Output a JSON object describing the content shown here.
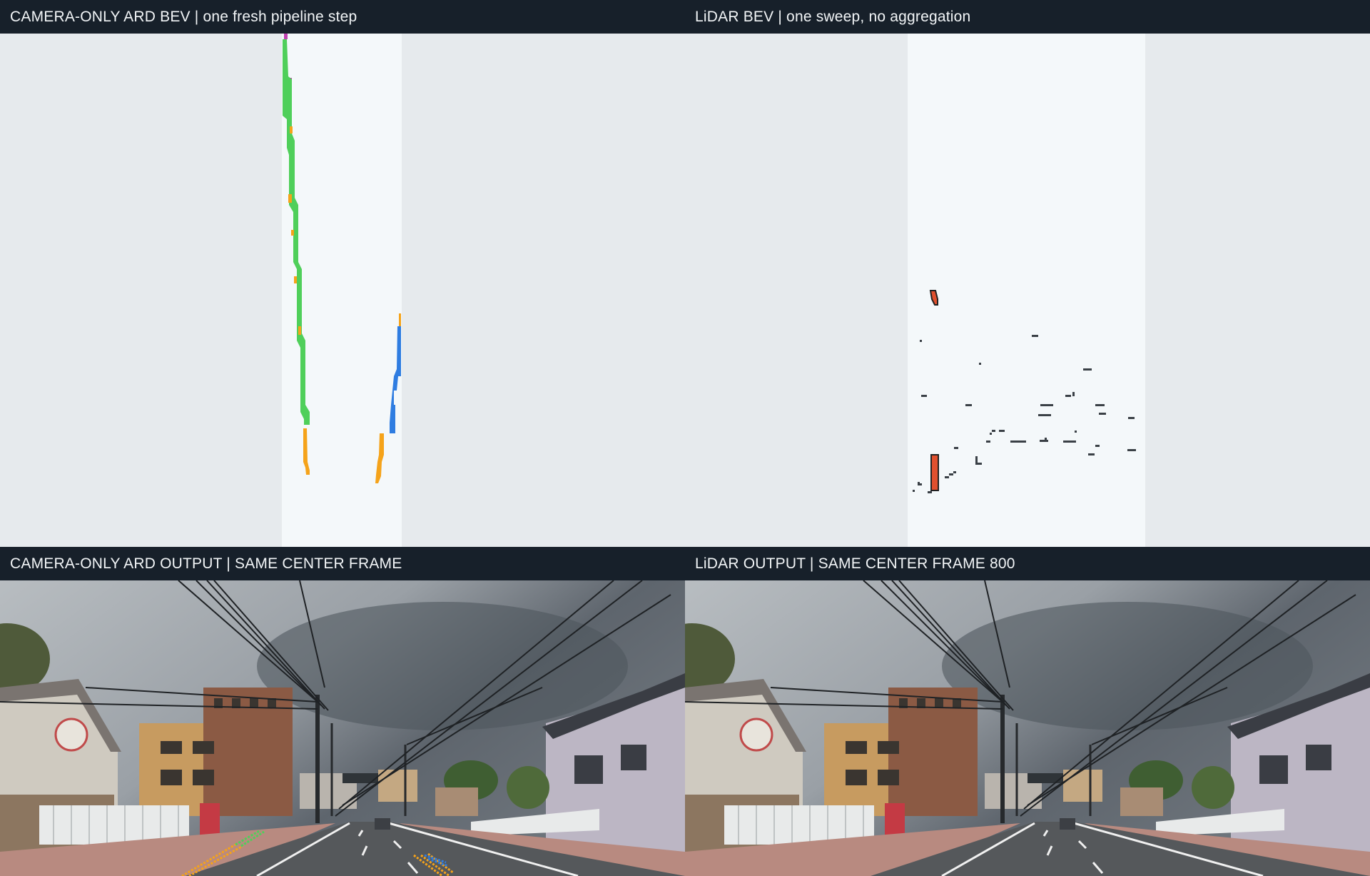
{
  "panels": {
    "top_left": {
      "title": "CAMERA-ONLY ARD BEV | one fresh pipeline step"
    },
    "top_right": {
      "title": "LiDAR BEV | one sweep, no aggregation"
    },
    "bottom_left": {
      "title": "CAMERA-ONLY ARD OUTPUT | SAME CENTER FRAME"
    },
    "bottom_right": {
      "title": "LiDAR OUTPUT | SAME CENTER FRAME 800"
    }
  },
  "colors": {
    "header_bg": "#17202a",
    "header_text": "#f2f5f7",
    "bev_bg": "#e6eaed",
    "bev_roi": "#f4f8fa",
    "lane_green": "#4fcf5a",
    "lane_orange": "#f5a31a",
    "lane_blue": "#2f7de1",
    "lane_magenta": "#c040b0",
    "lidar_point": "#3a4046",
    "lidar_object": "#e0502e"
  }
}
